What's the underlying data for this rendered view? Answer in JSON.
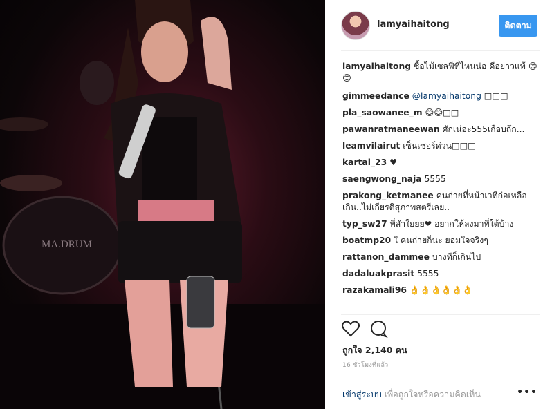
{
  "post": {
    "username": "lamyaihaitong",
    "follow_label": "ติดตาม",
    "caption": "ซื้อไม้เซลฟีที่ไหนน่อ คือยาวแท้ 😊😊",
    "comments": [
      {
        "user": "gimmeedance",
        "mention": "@lamyaihaitong",
        "text": " □□□"
      },
      {
        "user": "pla_saowanee_m",
        "mention": "",
        "text": "😊😊□□"
      },
      {
        "user": "pawanratmaneewan",
        "mention": "",
        "text": "ศักเน่อะ555เกือบถึก..."
      },
      {
        "user": "leamvilairut",
        "mention": "",
        "text": "เซ็นเซอร์ด่วน□□□"
      },
      {
        "user": "kartai_23",
        "mention": "",
        "text": "♥"
      },
      {
        "user": "saengwong_naja",
        "mention": "",
        "text": "5555"
      },
      {
        "user": "prakong_ketmanee",
        "mention": "",
        "text": "คนถ่ายที่หน้าเวทีก่อเหลือเกิน..ไม่เกียรติสุภาพสตรีเลย.."
      },
      {
        "user": "typ_sw27",
        "mention": "",
        "text": "พี่ลำใยยย❤ อยากให้ลงมาที่ใต้บ้าง"
      },
      {
        "user": "boatmp20",
        "mention": "",
        "text": "ใ คนถ่ายก็นะ ยอมใจจริงๆ"
      },
      {
        "user": "rattanon_dammee",
        "mention": "",
        "text": "บางทีก็เกินไป"
      },
      {
        "user": "dadaluakprasit",
        "mention": "",
        "text": "5555"
      },
      {
        "user": "razakamali96",
        "mention": "",
        "text": "👌👌👌👌👌👌"
      }
    ],
    "likes_text": "ถูกใจ 2,140 คน",
    "time_text": "16 ชั่วโมงที่แล้ว",
    "login_link": "เข้าสู่ระบบ",
    "login_rest": "เพื่อถูกใจหรือความคิดเห็น",
    "more_label": "•••"
  },
  "photo": {
    "drum_text": "MA.DRUM"
  },
  "colors": {
    "accent": "#3897f0",
    "link": "#003569",
    "muted": "#999999"
  }
}
